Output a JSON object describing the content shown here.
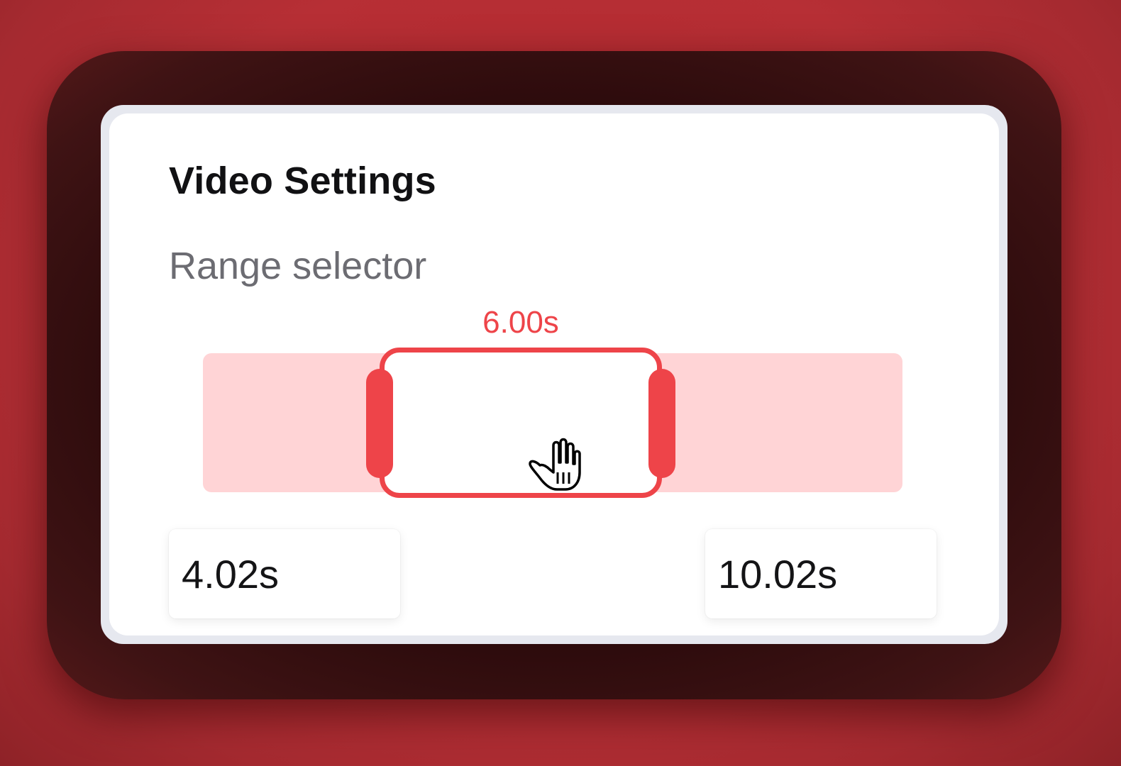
{
  "card": {
    "title": "Video Settings",
    "subtitle": "Range selector"
  },
  "range": {
    "duration_label": "6.00s",
    "start_value": "4.02s",
    "end_value": "10.02s"
  },
  "cursor": {
    "icon": "grab-hand-icon"
  },
  "colors": {
    "accent": "#ee4449",
    "track": "#ffd4d6",
    "background": "#b3262c"
  }
}
